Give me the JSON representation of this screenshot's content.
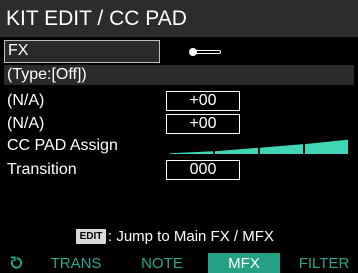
{
  "header": {
    "title": "KIT EDIT / CC PAD"
  },
  "fx": {
    "label": "FX",
    "toggle_state": "off"
  },
  "type_row": {
    "text": "(Type:[Off])"
  },
  "params": [
    {
      "label": "(N/A)",
      "value": "+00"
    },
    {
      "label": "(N/A)",
      "value": "+00"
    }
  ],
  "cc_pad": {
    "label": "CC PAD Assign",
    "bar_levels": [
      0.15,
      0.35,
      0.55,
      0.8
    ],
    "bar_color": "#3fd6b5"
  },
  "transition": {
    "label": "Transition",
    "value": "000"
  },
  "hint": {
    "key_label": "EDIT",
    "text": ": Jump to Main FX / MFX"
  },
  "tabs": {
    "icon": "rotate-icon",
    "items": [
      {
        "label": "TRANS",
        "active": false
      },
      {
        "label": "NOTE",
        "active": false
      },
      {
        "label": "MFX",
        "active": true
      },
      {
        "label": "FILTER",
        "active": false
      }
    ]
  },
  "colors": {
    "accent": "#25a085",
    "tab_text": "#24a890",
    "header_bg": "#2c2c2c"
  }
}
